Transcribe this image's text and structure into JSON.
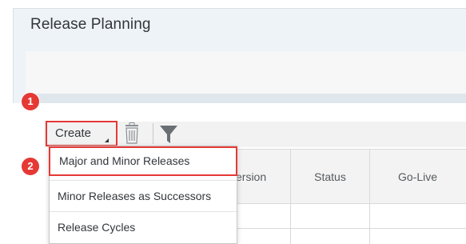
{
  "page": {
    "title": "Release Planning"
  },
  "toolbar": {
    "create_label": "Create"
  },
  "table": {
    "columns": [
      {
        "label": "ersion"
      },
      {
        "label": "Status"
      },
      {
        "label": "Go-Live"
      }
    ]
  },
  "dropdown": {
    "items": [
      {
        "label": "Major and Minor Releases"
      },
      {
        "label": "Minor Releases as Successors"
      },
      {
        "label": "Release Cycles"
      }
    ]
  },
  "callouts": [
    {
      "number": "1"
    },
    {
      "number": "2"
    }
  ],
  "colors": {
    "highlight": "#e53935",
    "header_bg": "#edf3f7",
    "toolbar_bg": "#f2f2f2",
    "text": "#32363a"
  },
  "icons": [
    "trash-icon",
    "filter-icon",
    "dropdown-caret-icon"
  ]
}
